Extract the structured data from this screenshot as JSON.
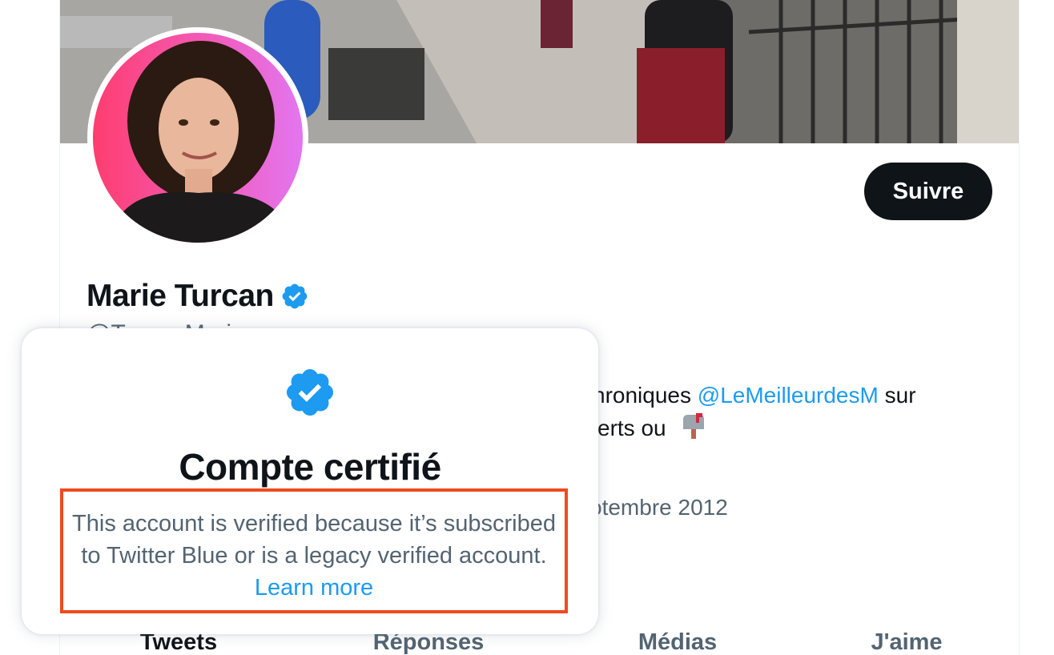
{
  "profile": {
    "display_name": "Marie Turcan",
    "handle": "@TurcanMarie",
    "follow_button": "Suivre",
    "bio_visible_start": "hroniques",
    "bio_mention": "@LeMeilleurdesM",
    "bio_after_mention": "sur",
    "bio_line2_visible": "erts ou",
    "joined_visible": "otembre 2012",
    "verified_icon": "verified-badge-icon"
  },
  "tabs": [
    {
      "label": "Tweets",
      "active": true
    },
    {
      "label": "Réponses",
      "active": false
    },
    {
      "label": "Médias",
      "active": false
    },
    {
      "label": "J'aime",
      "active": false
    }
  ],
  "hovercard": {
    "title": "Compte certifié",
    "description": "This account is verified because it’s subscribed to Twitter Blue or is a legacy verified account.",
    "learn_more": "Learn more"
  },
  "colors": {
    "accent_blue": "#1d9bf0",
    "highlight_border": "#f04a1d",
    "text_primary": "#0f1419",
    "text_secondary": "#536471"
  }
}
